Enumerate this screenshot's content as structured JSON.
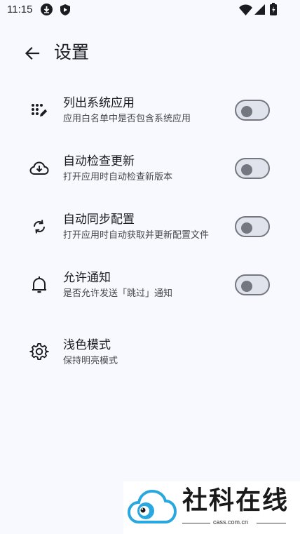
{
  "status_bar": {
    "time": "11:15",
    "icons": [
      "download-icon",
      "shield-icon",
      "wifi-icon",
      "signal-icon",
      "battery-icon"
    ]
  },
  "toolbar": {
    "back_icon": "arrow-back-icon",
    "title": "设置"
  },
  "settings": [
    {
      "icon": "dots-pen-icon",
      "title": "列出系统应用",
      "subtitle": "应用白名单中是否包含系统应用",
      "toggle": false
    },
    {
      "icon": "cloud-download-icon",
      "title": "自动检查更新",
      "subtitle": "打开应用时自动检查新版本",
      "toggle": false
    },
    {
      "icon": "sync-icon",
      "title": "自动同步配置",
      "subtitle": "打开应用时自动获取并更新配置文件",
      "toggle": false
    },
    {
      "icon": "bell-icon",
      "title": "允许通知",
      "subtitle": "是否允许发送「跳过」通知",
      "toggle": false
    },
    {
      "icon": "gear-icon",
      "title": "浅色模式",
      "subtitle": "保持明亮模式"
    }
  ],
  "watermark": {
    "text": "社科在线",
    "domain": "cass.com.cn"
  },
  "colors": {
    "background": "#f8f9ff",
    "text_primary": "#1b1c20",
    "text_secondary": "#44474e",
    "toggle_border": "#74777f",
    "toggle_track": "#e0e2ec",
    "status_icon_accent": "#1b1c20"
  }
}
